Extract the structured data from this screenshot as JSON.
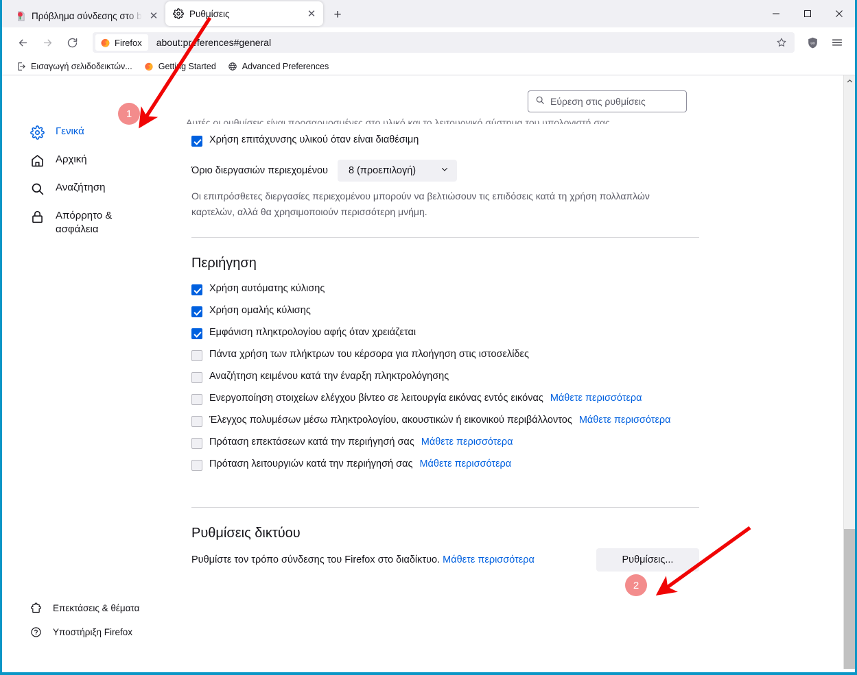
{
  "window": {
    "controls": {
      "minimize": "—",
      "maximize": "☐",
      "close": "✕"
    }
  },
  "tabs": [
    {
      "title": "Πρόβλημα σύνδεσης στο bourd",
      "favicon": "broken-page-icon",
      "active": false,
      "close": "✕"
    },
    {
      "title": "Ρυθμίσεις",
      "favicon": "gear-icon",
      "active": true,
      "close": "✕"
    }
  ],
  "newtab_label": "+",
  "toolbar": {
    "back": "←",
    "forward": "→",
    "reload": "↻",
    "identity_label": "Firefox",
    "url": "about:preferences#general",
    "bookmark_star": "☆",
    "extension_label": "uBlock Origin",
    "menu_label": "Άνοιγμα μενού εφαρμογών"
  },
  "bookmarks": [
    {
      "label": "Εισαγωγή σελιδοδεικτών...",
      "icon": "import-icon"
    },
    {
      "label": "Getting Started",
      "icon": "firefox-icon"
    },
    {
      "label": "Advanced Preferences",
      "icon": "globe-icon"
    }
  ],
  "search": {
    "placeholder": "Εύρεση στις ρυθμίσεις",
    "icon": "search-icon"
  },
  "sidebar": {
    "items": [
      {
        "label": "Γενικά",
        "icon": "gear-icon",
        "active": true
      },
      {
        "label": "Αρχική",
        "icon": "home-icon",
        "active": false
      },
      {
        "label": "Αναζήτηση",
        "icon": "search-icon",
        "active": false
      },
      {
        "label": "Απόρρητο & ασφάλεια",
        "icon": "lock-icon",
        "active": false
      }
    ],
    "bottom_items": [
      {
        "label": "Επεκτάσεις & θέματα",
        "icon": "puzzle-icon"
      },
      {
        "label": "Υποστήριξη Firefox",
        "icon": "question-circle-icon"
      }
    ]
  },
  "main": {
    "clipped_text": "Αυτές οι ρυθμίσεις είναι προσαρμοσμένες στο υλικό και το λειτουργικό σύστημα του υπολογιστή σας.",
    "hw_accel": {
      "label": "Χρήση επιτάχυνσης υλικού όταν είναι διαθέσιμη",
      "checked": true,
      "accesskey": "λ"
    },
    "process_limit": {
      "label": "Όριο διεργασιών περιεχομένου",
      "value": "8 (προεπιλογή)",
      "chevron": "⌄"
    },
    "process_desc": "Οι επιπρόσθετες διεργασίες περιεχομένου μπορούν να βελτιώσουν τις επιδόσεις κατά τη χρήση πολλαπλών καρτελών, αλλά θα χρησιμοποιούν περισσότερη μνήμη.",
    "browsing_title": "Περιήγηση",
    "browsing_options": [
      {
        "label": "Χρήση αυτόματης κύλισης",
        "checked": true,
        "link": ""
      },
      {
        "label": "Χρήση ομαλής κύλισης",
        "checked": true,
        "link": ""
      },
      {
        "label": "Εμφάνιση πληκτρολογίου αφής όταν χρειάζεται",
        "checked": true,
        "link": ""
      },
      {
        "label": "Πάντα χρήση των πλήκτρων του κέρσορα για πλοήγηση στις ιστοσελίδες",
        "checked": false,
        "link": ""
      },
      {
        "label": "Αναζήτηση κειμένου κατά την έναρξη πληκτρολόγησης",
        "checked": false,
        "link": ""
      },
      {
        "label": "Ενεργοποίηση στοιχείων ελέγχου βίντεο σε λειτουργία εικόνας εντός εικόνας",
        "checked": false,
        "link": "Μάθετε περισσότερα"
      },
      {
        "label": "Έλεγχος πολυμέσων μέσω πληκτρολογίου, ακουστικών ή εικονικού περιβάλλοντος",
        "checked": false,
        "link": "Μάθετε περισσότερα"
      },
      {
        "label": "Πρόταση επεκτάσεων κατά την περιήγησή σας",
        "checked": false,
        "link": "Μάθετε περισσότερα"
      },
      {
        "label": "Πρόταση λειτουργιών κατά την περιήγησή σας",
        "checked": false,
        "link": "Μάθετε περισσότερα"
      }
    ],
    "network_title": "Ρυθμίσεις δικτύου",
    "network_desc": "Ρυθμίστε τον τρόπο σύνδεσης του Firefox στο διαδίκτυο.",
    "network_link": "Μάθετε περισσότερα",
    "network_button": "Ρυθμίσεις..."
  },
  "annotations": [
    {
      "id": "1",
      "label": "1"
    },
    {
      "id": "2",
      "label": "2"
    }
  ],
  "colors": {
    "accent": "#0060df",
    "link": "#0060df",
    "annotation": "#eb4646",
    "window_border": "#0a96c6",
    "chrome_bg": "#f0f0f4"
  }
}
